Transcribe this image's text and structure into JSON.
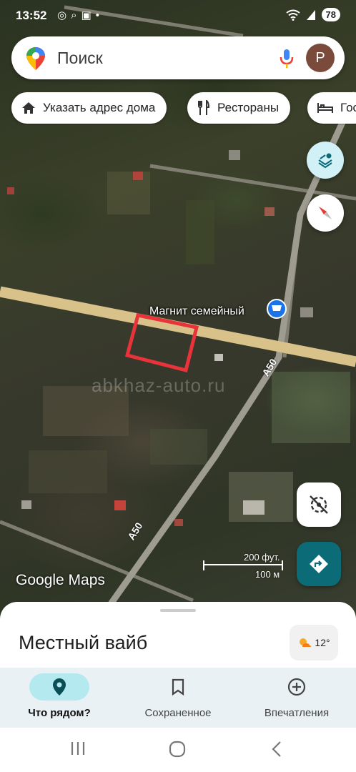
{
  "status": {
    "time": "13:52",
    "battery": "78"
  },
  "search": {
    "placeholder": "Поиск",
    "avatar_letter": "Р"
  },
  "chips": [
    {
      "label": "Указать адрес дома",
      "icon": "home-icon"
    },
    {
      "label": "Рестораны",
      "icon": "fork-knife-icon"
    },
    {
      "label": "Гос",
      "icon": "bed-icon"
    }
  ],
  "map": {
    "place_label": "Магнит семейный",
    "road_labels": [
      "A50",
      "A50"
    ],
    "watermark": "abkhaz-auto.ru",
    "logo": "Google Maps",
    "scale": {
      "imperial": "200 фут.",
      "metric": "100 м"
    }
  },
  "sheet": {
    "title": "Местный вайб",
    "weather": "12°"
  },
  "bottom_nav": [
    {
      "label": "Что рядом?",
      "icon": "location-pin-icon",
      "active": true
    },
    {
      "label": "Сохраненное",
      "icon": "bookmark-icon",
      "active": false
    },
    {
      "label": "Впечатления",
      "icon": "add-circle-icon",
      "active": false
    }
  ],
  "colors": {
    "accent": "#0b6c78",
    "active_nav": "#b5e9f0",
    "highlight": "#e8333a",
    "road": "#d8c28a"
  }
}
